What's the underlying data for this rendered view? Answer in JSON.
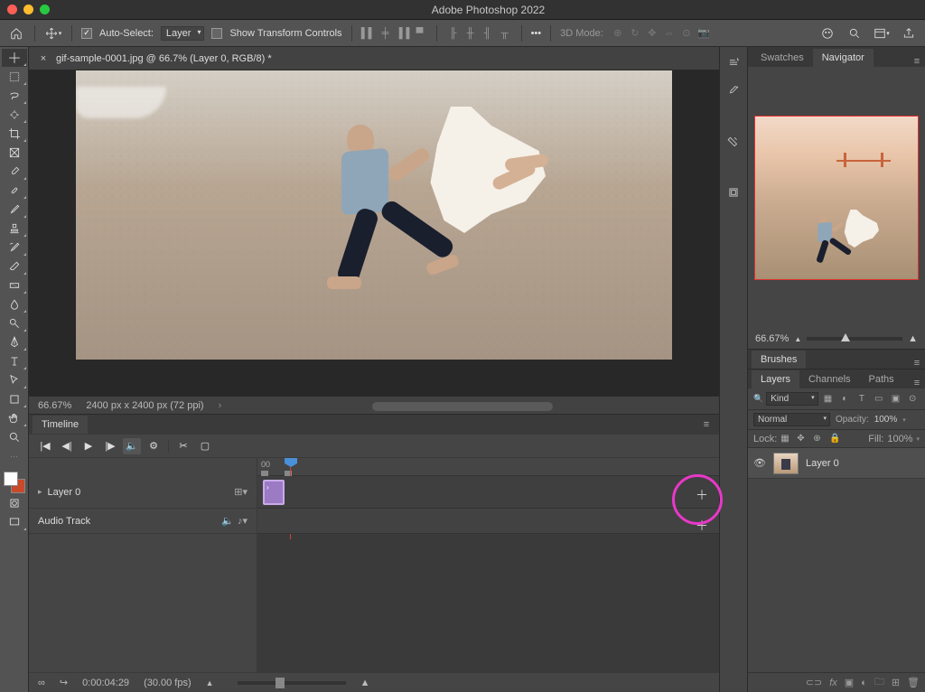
{
  "app_title": "Adobe Photoshop 2022",
  "options_bar": {
    "auto_select_label": "Auto-Select:",
    "auto_select_value": "Layer",
    "show_transform_label": "Show Transform Controls",
    "ellipsis": "•••",
    "mode_3d_label": "3D Mode:"
  },
  "document": {
    "tab_title": "gif-sample-0001.jpg @ 66.7% (Layer 0, RGB/8) *",
    "status_zoom": "66.67%",
    "status_dims": "2400 px x 2400 px (72 ppi)"
  },
  "navigator": {
    "tab_swatches": "Swatches",
    "tab_navigator": "Navigator",
    "zoom_value": "66.67%"
  },
  "brushes": {
    "title": "Brushes"
  },
  "layers_panel": {
    "tab_layers": "Layers",
    "tab_channels": "Channels",
    "tab_paths": "Paths",
    "filter_kind": "Kind",
    "blend_mode": "Normal",
    "opacity_label": "Opacity:",
    "opacity_value": "100%",
    "lock_label": "Lock:",
    "fill_label": "Fill:",
    "fill_value": "100%",
    "items": [
      {
        "name": "Layer 0",
        "visible": true
      }
    ]
  },
  "timeline": {
    "tab_label": "Timeline",
    "ruler_start": "00",
    "left_tracks": [
      {
        "name": "Layer 0"
      },
      {
        "name": "Audio Track"
      }
    ],
    "footer_time": "0:00:04:29",
    "footer_fps": "(30.00 fps)"
  },
  "icons": {
    "home": "⌂",
    "move": "✥",
    "search": "🔍",
    "cloud": "☁",
    "share": "⇪",
    "panel": "▥",
    "history": "↺",
    "props": "≡",
    "brush": "🖌",
    "wrench": "✕",
    "square": "▢"
  }
}
